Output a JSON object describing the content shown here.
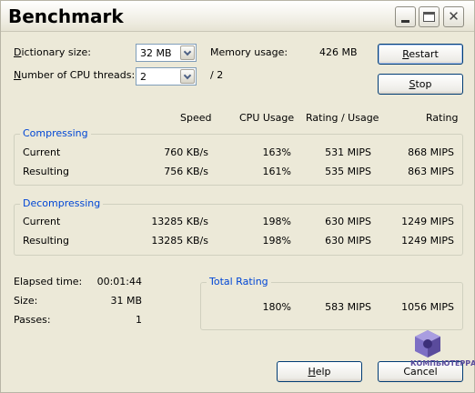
{
  "window": {
    "title": "Benchmark"
  },
  "settings": {
    "dictionary_label": "Dictionary size:",
    "dictionary_value": "32 MB",
    "threads_label": "Number of CPU threads:",
    "threads_value": "2",
    "threads_max": "/ 2",
    "memory_label": "Memory usage:",
    "memory_value": "426 MB"
  },
  "buttons": {
    "restart": "Restart",
    "stop": "Stop",
    "help": "Help",
    "cancel": "Cancel"
  },
  "columns": {
    "speed": "Speed",
    "cpu_usage": "CPU Usage",
    "rating_usage": "Rating / Usage",
    "rating": "Rating"
  },
  "compressing": {
    "title": "Compressing",
    "rows": [
      {
        "label": "Current",
        "speed": "760 KB/s",
        "cpu": "163%",
        "rating_usage": "531 MIPS",
        "rating": "868 MIPS"
      },
      {
        "label": "Resulting",
        "speed": "756 KB/s",
        "cpu": "161%",
        "rating_usage": "535 MIPS",
        "rating": "863 MIPS"
      }
    ]
  },
  "decompressing": {
    "title": "Decompressing",
    "rows": [
      {
        "label": "Current",
        "speed": "13285 KB/s",
        "cpu": "198%",
        "rating_usage": "630 MIPS",
        "rating": "1249 MIPS"
      },
      {
        "label": "Resulting",
        "speed": "13285 KB/s",
        "cpu": "198%",
        "rating_usage": "630 MIPS",
        "rating": "1249 MIPS"
      }
    ]
  },
  "stats": {
    "elapsed_label": "Elapsed time:",
    "elapsed_value": "00:01:44",
    "size_label": "Size:",
    "size_value": "31 MB",
    "passes_label": "Passes:",
    "passes_value": "1"
  },
  "total_rating": {
    "title": "Total Rating",
    "cpu": "180%",
    "rating_usage": "583 MIPS",
    "rating": "1056 MIPS"
  },
  "watermark": {
    "text": "КОМПЬЮТЕРРА"
  },
  "colors": {
    "group_title": "#0046d5",
    "dialog_bg": "#ece9d8",
    "button_border": "#003c74"
  }
}
